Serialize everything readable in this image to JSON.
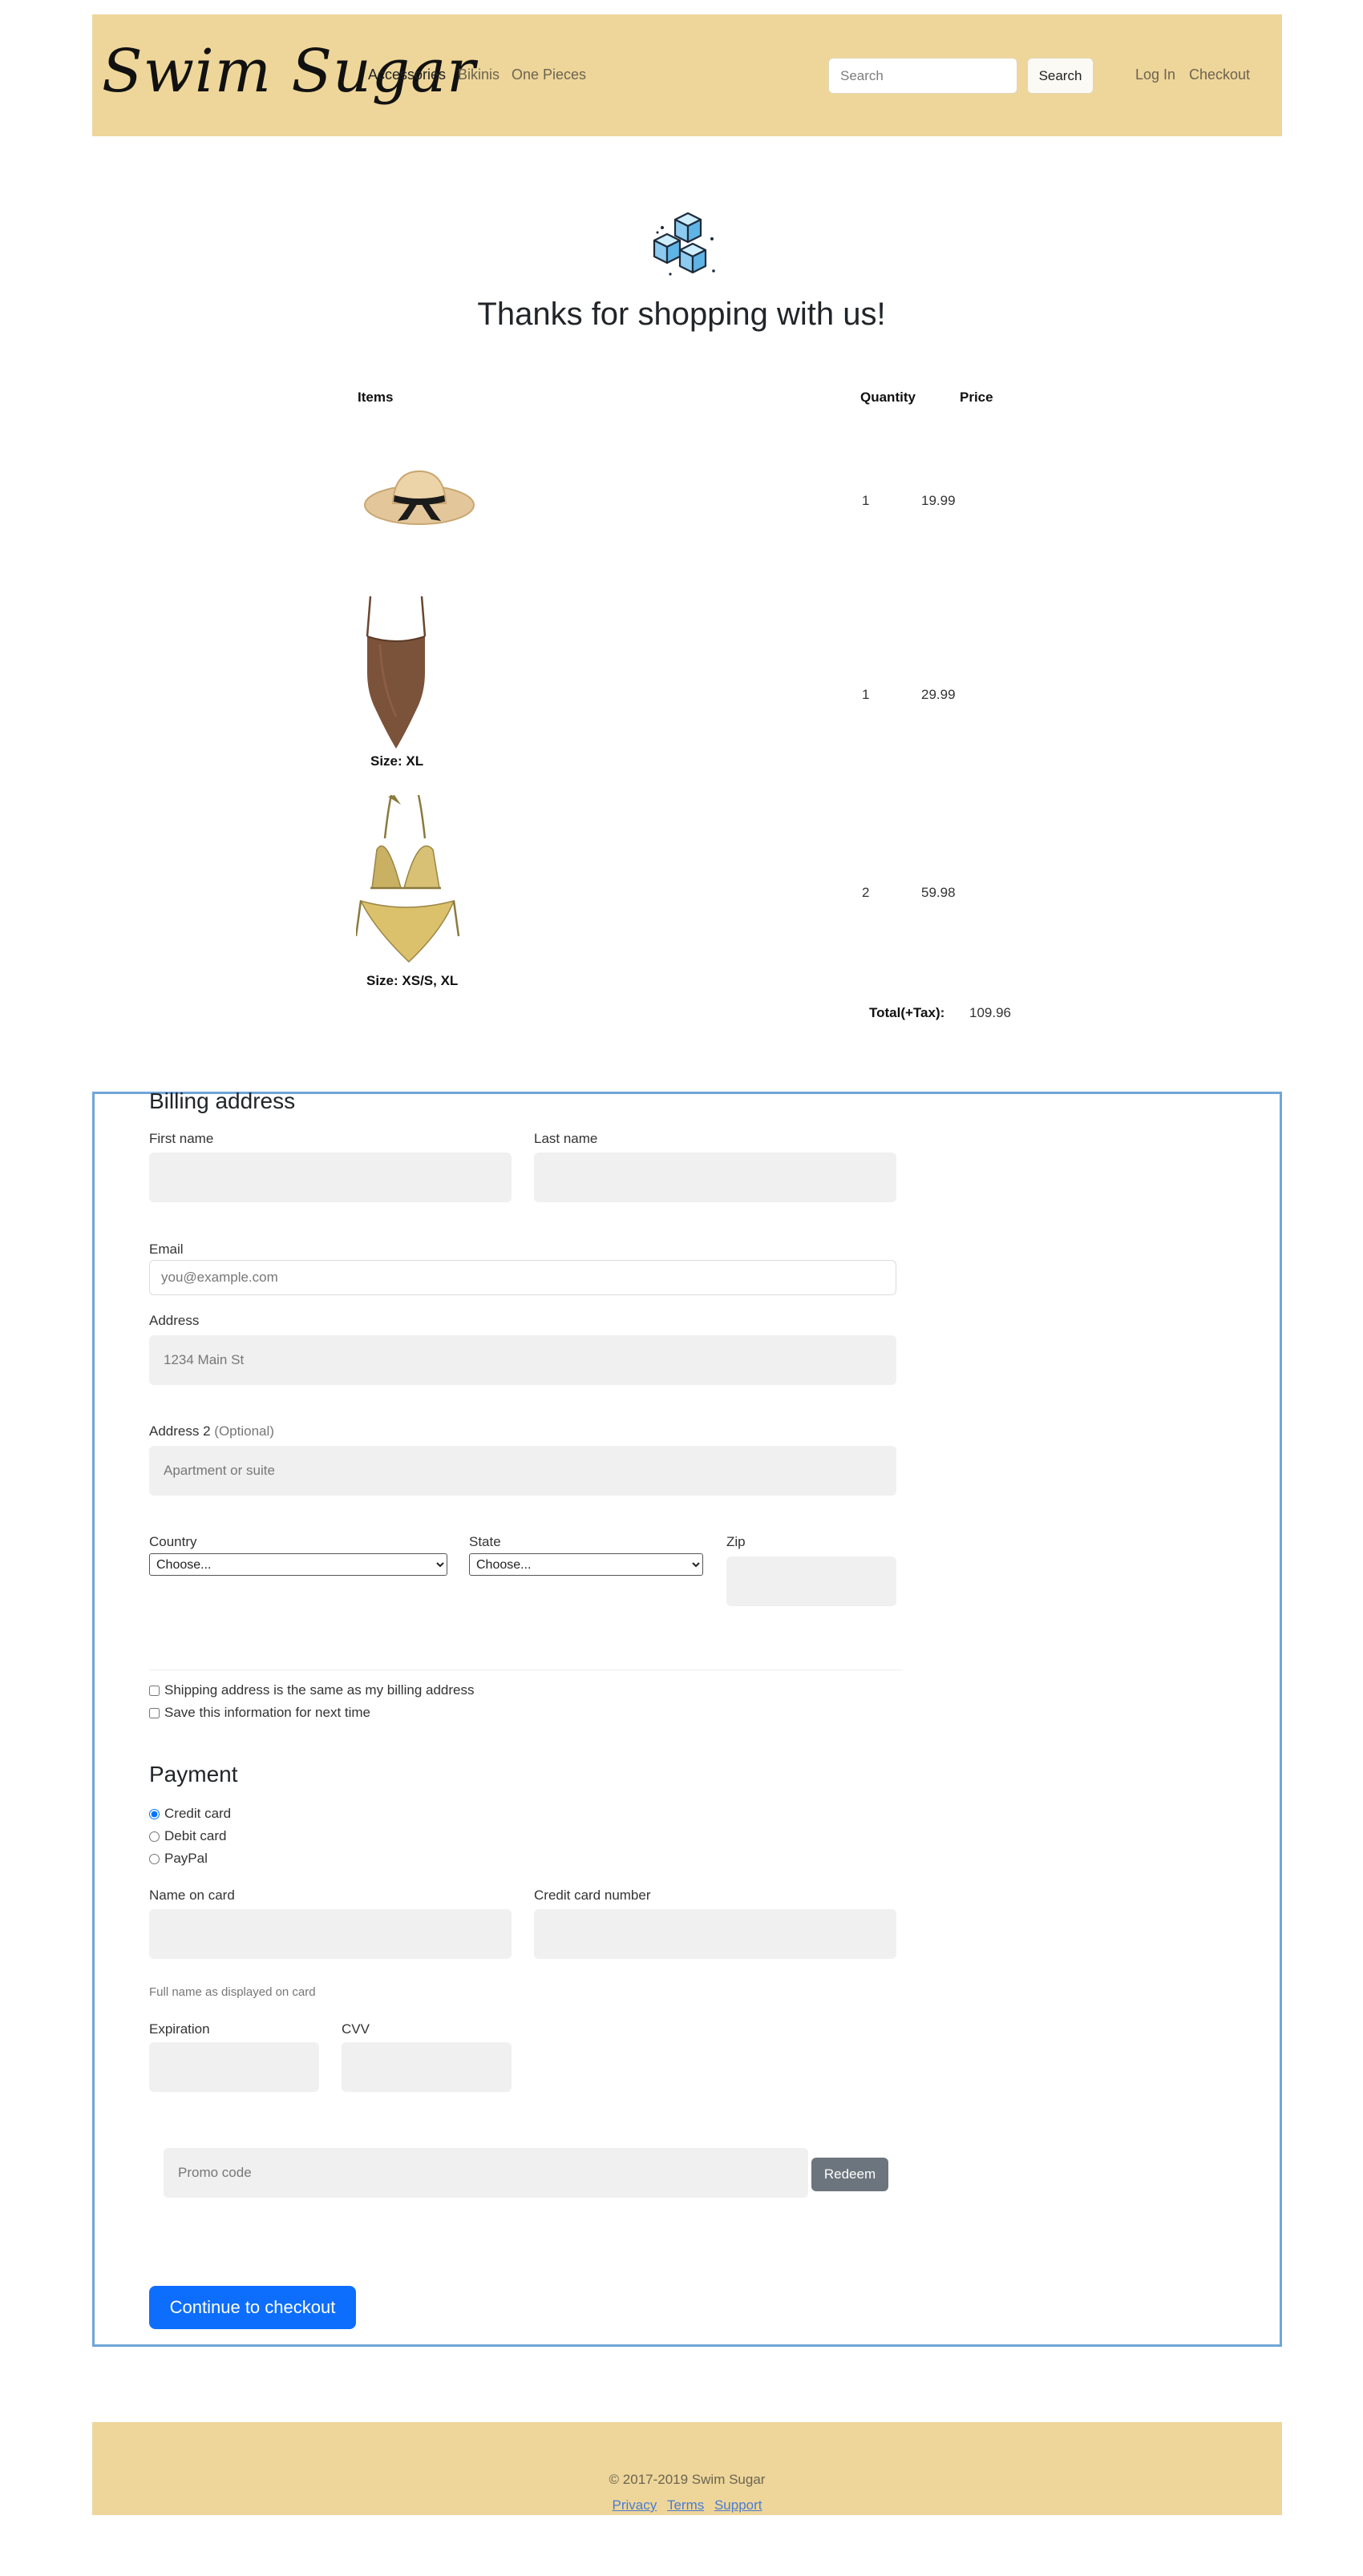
{
  "navbar": {
    "brand": "Swim Sugar",
    "links": [
      "Accessories",
      "Bikinis",
      "One Pieces"
    ],
    "search_placeholder": "Search",
    "search_button": "Search",
    "login": "Log In",
    "checkout": "Checkout"
  },
  "hero": {
    "icon": "ice-cubes-icon",
    "title": "Thanks for shopping with us!"
  },
  "cart": {
    "headers": {
      "items": "Items",
      "quantity": "Quantity",
      "price": "Price"
    },
    "items": [
      {
        "image": "straw-hat-image",
        "size": "",
        "quantity": "1",
        "price": "19.99"
      },
      {
        "image": "brown-one-piece-swimsuit-image",
        "size": "Size: XL",
        "quantity": "1",
        "price": "29.99"
      },
      {
        "image": "gold-bikini-image",
        "size": "Size: XS/S, XL",
        "quantity": "2",
        "price": "59.98"
      }
    ],
    "total_label": "Total(+Tax):",
    "total_value": "109.96"
  },
  "billing": {
    "title": "Billing address",
    "first_name": "First name",
    "last_name": "Last name",
    "email": "Email",
    "email_placeholder": "you@example.com",
    "address": "Address",
    "address_placeholder": "1234 Main St",
    "address2": "Address 2",
    "address2_optional": "(Optional)",
    "address2_placeholder": "Apartment or suite",
    "country": "Country",
    "country_selected": "Choose...",
    "state": "State",
    "state_selected": "Choose...",
    "zip": "Zip",
    "same_address": "Shipping address is the same as my billing address",
    "save_info": "Save this information for next time"
  },
  "payment": {
    "title": "Payment",
    "methods": [
      "Credit card",
      "Debit card",
      "PayPal"
    ],
    "selected_method": "Credit card",
    "name_on_card": "Name on card",
    "name_help": "Full name as displayed on card",
    "card_number": "Credit card number",
    "expiration": "Expiration",
    "cvv": "CVV",
    "promo_placeholder": "Promo code",
    "redeem": "Redeem",
    "continue": "Continue to checkout"
  },
  "footer": {
    "copyright": "© 2017-2019 Swim Sugar",
    "links": [
      "Privacy",
      "Terms",
      "Support"
    ]
  },
  "colors": {
    "navbar_bg": "#eed69a",
    "primary_button": "#0d6efd",
    "secondary_button": "#6c757d",
    "billing_border": "#6fa6d8"
  }
}
